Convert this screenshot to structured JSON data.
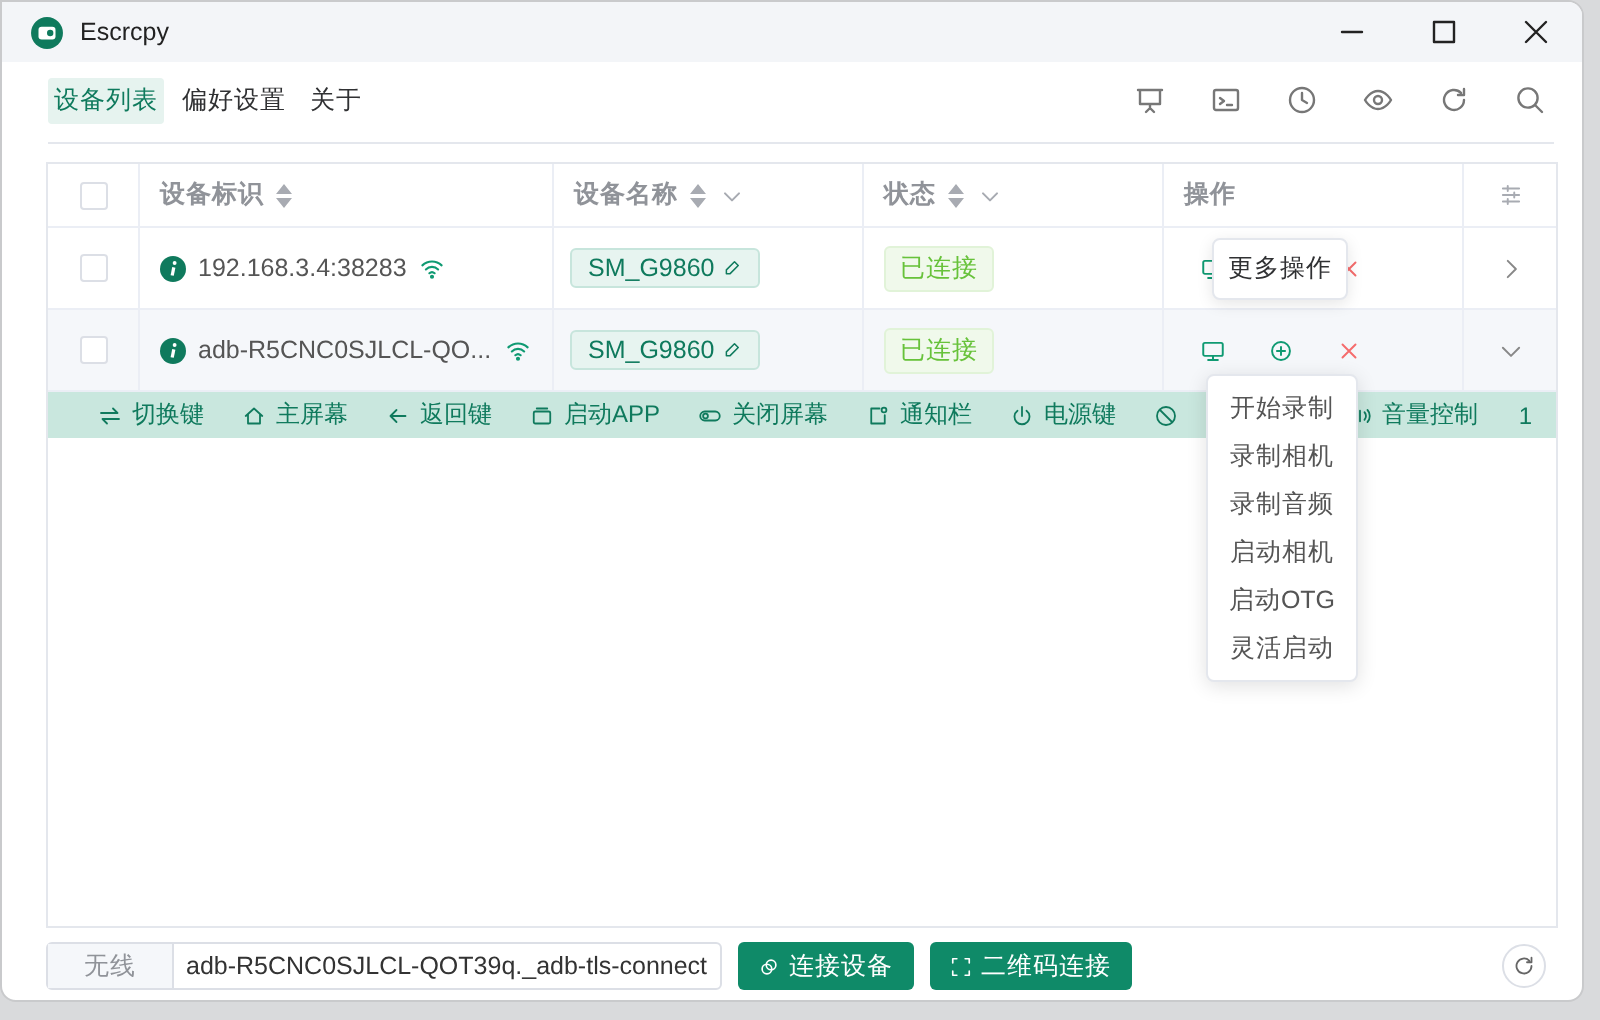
{
  "window": {
    "title": "Escrcpy"
  },
  "tabs": [
    {
      "label": "设备列表",
      "selected": true
    },
    {
      "label": "偏好设置",
      "selected": false
    },
    {
      "label": "关于",
      "selected": false
    }
  ],
  "table": {
    "select_all": false,
    "columns": [
      {
        "label": "设备标识",
        "sortable": true,
        "filterable": false
      },
      {
        "label": "设备名称",
        "sortable": true,
        "filterable": true
      },
      {
        "label": "状态",
        "sortable": true,
        "filterable": true
      },
      {
        "label": "操作",
        "sortable": false,
        "filterable": false
      }
    ],
    "rows": [
      {
        "id": "192.168.3.4:38283",
        "name": "SM_G9860",
        "status": "已连接",
        "checked": false,
        "expanded": false,
        "actions": [
          {
            "kind": "mirror"
          },
          {
            "kind": "disconnect"
          }
        ]
      },
      {
        "id": "adb-R5CNC0SJLCL-QO...",
        "name": "SM_G9860",
        "status": "已连接",
        "checked": false,
        "expanded": true,
        "actions": [
          {
            "kind": "mirror"
          },
          {
            "kind": "more"
          },
          {
            "kind": "disconnect"
          }
        ]
      }
    ]
  },
  "device_controls": [
    {
      "kind": "labeled",
      "label": "切换键"
    },
    {
      "kind": "labeled",
      "label": "主屏幕"
    },
    {
      "kind": "labeled",
      "label": "返回键"
    },
    {
      "kind": "labeled",
      "label": "启动APP"
    },
    {
      "kind": "labeled",
      "label": "关闭屏幕"
    },
    {
      "kind": "labeled",
      "label": "通知栏"
    },
    {
      "kind": "labeled",
      "label": "电源键"
    },
    {
      "kind": "icon"
    },
    {
      "kind": "labeled",
      "label": "音量控制"
    }
  ],
  "device_controls_trailing": "1",
  "tooltip": {
    "text": "更多操作"
  },
  "menu": {
    "items": [
      "开始录制",
      "录制相机",
      "录制音频",
      "启动相机",
      "启动OTG",
      "灵活启动"
    ]
  },
  "connect_bar": {
    "prefix": "无线",
    "value": "adb-R5CNC0SJLCL-QOT39q._adb-tls-connect",
    "buttons": [
      "连接设备",
      "二维码连接"
    ]
  }
}
